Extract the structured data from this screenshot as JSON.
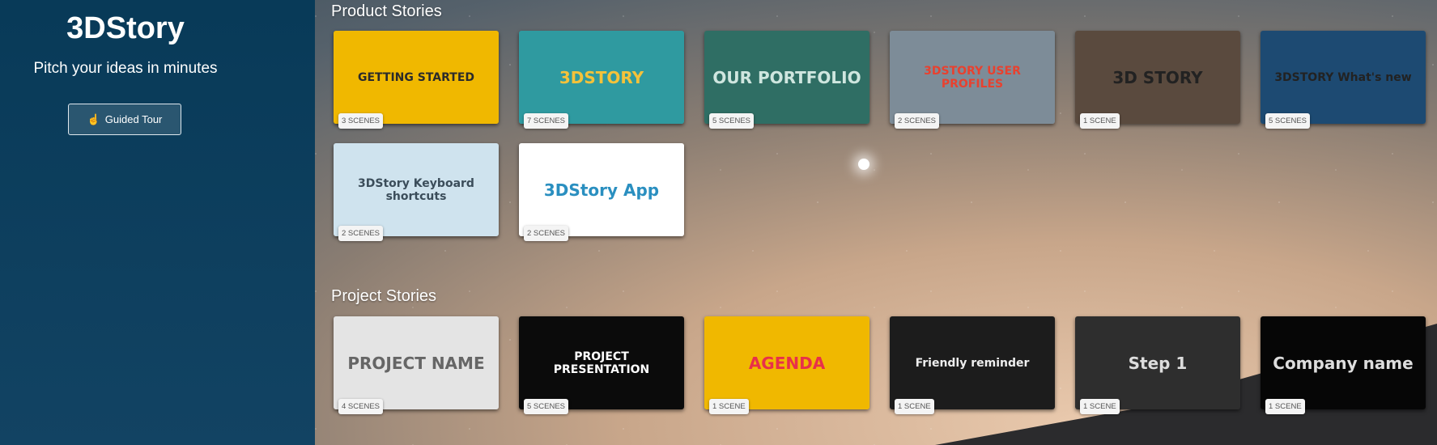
{
  "sidebar": {
    "brand": "3DStory",
    "tagline": "Pitch your ideas in minutes",
    "tour_label": "Guided Tour",
    "tour_icon": "hand-pointer-icon"
  },
  "sections": [
    {
      "title": "Product Stories",
      "cards": [
        {
          "title": "GETTING STARTED",
          "scenes": "3 SCENES",
          "bg": "#f0b800",
          "fg": "#2b2b2b"
        },
        {
          "title": "3DSTORY",
          "scenes": "7 SCENES",
          "bg": "#2f9aa0",
          "fg": "#f4c23a"
        },
        {
          "title": "OUR PORTFOLIO",
          "scenes": "5 SCENES",
          "bg": "#2f6e64",
          "fg": "#cfe6df"
        },
        {
          "title": "3DSTORY USER PROFILES",
          "scenes": "2 SCENES",
          "bg": "#7d8c98",
          "fg": "#e8412f"
        },
        {
          "title": "3D STORY",
          "scenes": "1 SCENE",
          "bg": "#5a4a3e",
          "fg": "#222"
        },
        {
          "title": "3DSTORY What's new",
          "scenes": "5 SCENES",
          "bg": "#1d4a72",
          "fg": "#222"
        },
        {
          "title": "3DStory Keyboard shortcuts",
          "scenes": "2 SCENES",
          "bg": "#cfe3ee",
          "fg": "#3b4d5a"
        },
        {
          "title": "3DStory App",
          "scenes": "2 SCENES",
          "bg": "#ffffff",
          "fg": "#2a8fc0"
        }
      ]
    },
    {
      "title": "Project Stories",
      "cards": [
        {
          "title": "PROJECT NAME",
          "scenes": "4 SCENES",
          "bg": "#e4e4e4",
          "fg": "#666"
        },
        {
          "title": "PROJECT PRESENTATION",
          "scenes": "5 SCENES",
          "bg": "#0b0b0b",
          "fg": "#fff"
        },
        {
          "title": "AGENDA",
          "scenes": "1 SCENE",
          "bg": "#f0b800",
          "fg": "#e8304a"
        },
        {
          "title": "Friendly reminder",
          "scenes": "1 SCENE",
          "bg": "#1c1c1c",
          "fg": "#eee"
        },
        {
          "title": "Step 1",
          "scenes": "1 SCENE",
          "bg": "#2e2e2e",
          "fg": "#ddd"
        },
        {
          "title": "Company name",
          "scenes": "1 SCENE",
          "bg": "#060606",
          "fg": "#ddd"
        }
      ]
    }
  ]
}
